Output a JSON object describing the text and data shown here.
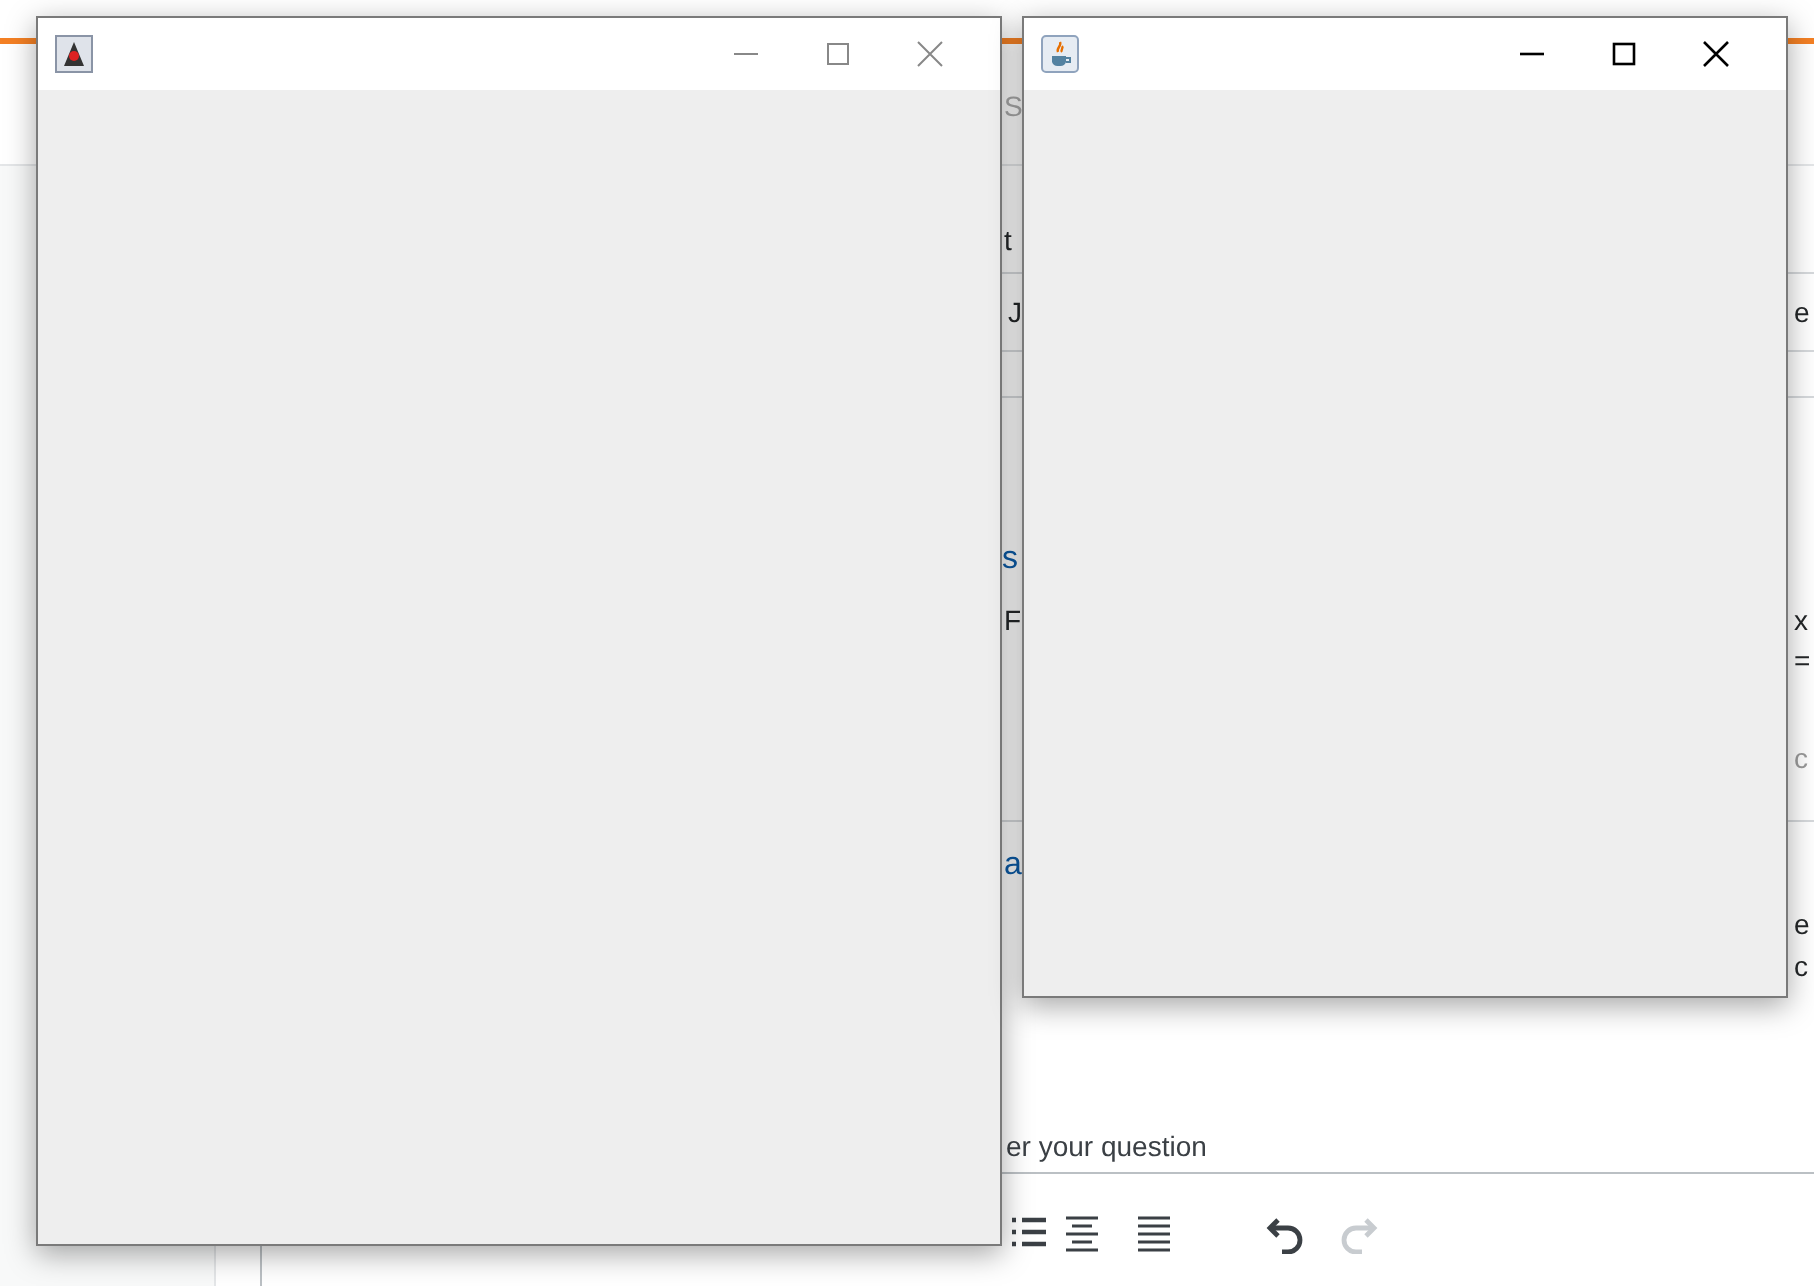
{
  "page": {
    "search_placeholder": "S",
    "fragments": [
      {
        "text": "t",
        "kind": "normal"
      },
      {
        "text": "J",
        "kind": "normal"
      },
      {
        "text": "e",
        "kind": "normal"
      },
      {
        "text": "s",
        "kind": "link"
      },
      {
        "text": "F",
        "kind": "normal"
      },
      {
        "text": "x",
        "kind": "normal"
      },
      {
        "text": "=",
        "kind": "normal"
      },
      {
        "text": "c",
        "kind": "muted"
      },
      {
        "text": "a",
        "kind": "link"
      },
      {
        "text": "e",
        "kind": "normal"
      },
      {
        "text": "c",
        "kind": "normal"
      }
    ],
    "answer_hint": "er your question",
    "editor_tools": [
      {
        "kind": "bullets",
        "disabled": false
      },
      {
        "kind": "center",
        "disabled": false
      },
      {
        "kind": "justify",
        "disabled": false
      },
      {
        "kind": "undo",
        "disabled": false
      },
      {
        "kind": "redo",
        "disabled": true
      }
    ]
  },
  "windows": [
    {
      "kind": "duke",
      "active": false
    },
    {
      "kind": "java",
      "active": true
    }
  ]
}
